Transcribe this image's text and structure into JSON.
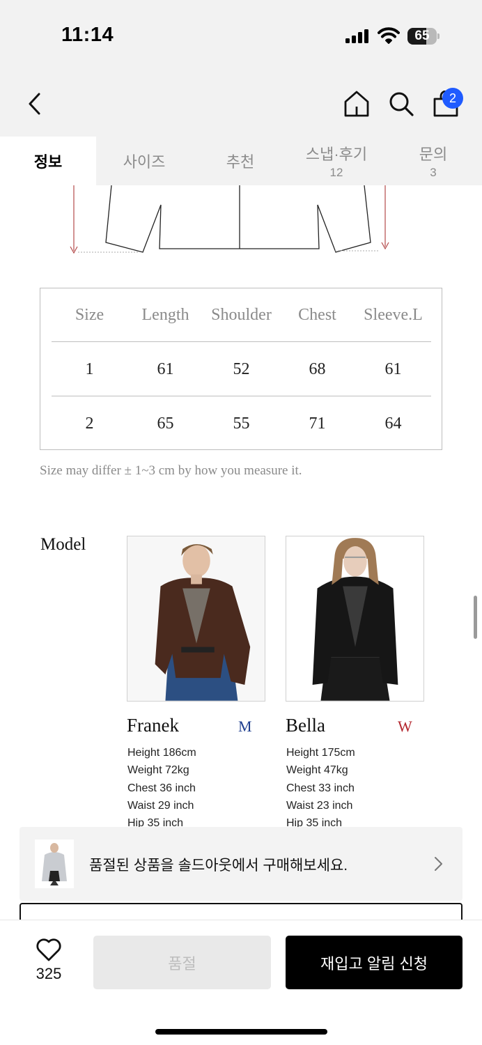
{
  "status_bar": {
    "time": "11:14",
    "battery_level": "65",
    "battery_fraction": 0.65
  },
  "header": {
    "cart_count": "2"
  },
  "tabs": [
    {
      "label": "정보",
      "count": ""
    },
    {
      "label": "사이즈",
      "count": ""
    },
    {
      "label": "추천",
      "count": ""
    },
    {
      "label": "스냅·후기",
      "count": "12"
    },
    {
      "label": "문의",
      "count": "3"
    }
  ],
  "size_table": {
    "headers": [
      "Size",
      "Length",
      "Shoulder",
      "Chest",
      "Sleeve.L"
    ],
    "rows": [
      [
        "1",
        "61",
        "52",
        "68",
        "61"
      ],
      [
        "2",
        "65",
        "55",
        "71",
        "64"
      ]
    ],
    "note": "Size may differ ± 1~3 cm by how you measure it."
  },
  "model_section": {
    "heading": "Model",
    "models": [
      {
        "name": "Franek",
        "tag": "M",
        "tag_color": "#1f3f8f",
        "specs": [
          "Height  186cm",
          "Weight  72kg",
          "Chest  36 inch",
          "Waist  29 inch",
          "Hip 35 inch"
        ]
      },
      {
        "name": "Bella",
        "tag": "W",
        "tag_color": "#b3262e",
        "specs": [
          "Height  175cm",
          "Weight  47kg",
          "Chest  33 inch",
          "Waist  23 inch",
          "Hip 35 inch"
        ]
      }
    ]
  },
  "promo": {
    "text": "품절된 상품을 솔드아웃에서 구매해보세요."
  },
  "action_bar": {
    "like_count": "325",
    "soldout_label": "품절",
    "restock_label": "재입고 알림 신청"
  },
  "colors": {
    "accent_blue": "#1f5bff",
    "header_bg": "#f2f2f2",
    "primary_button": "#000000"
  }
}
